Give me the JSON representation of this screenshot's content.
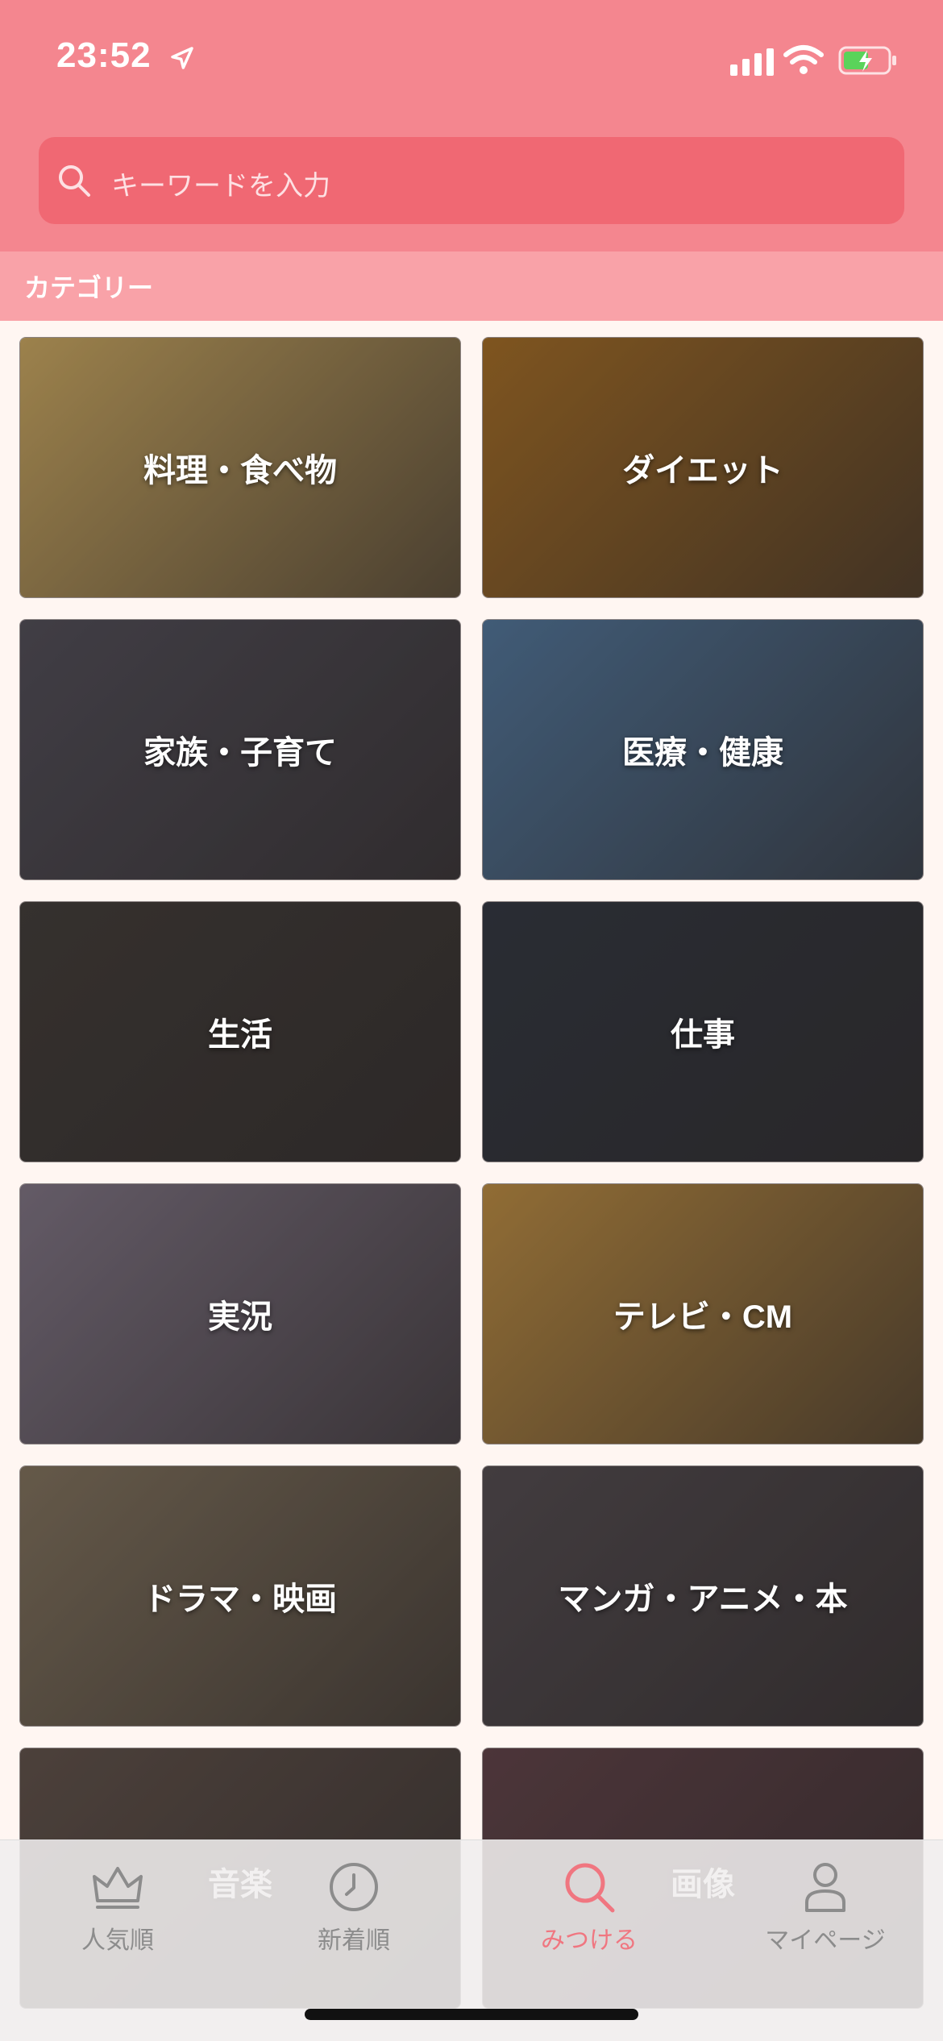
{
  "status_bar": {
    "time": "23:52"
  },
  "search": {
    "placeholder": "キーワードを入力"
  },
  "section": {
    "title": "カテゴリー"
  },
  "categories": [
    {
      "label": "料理・食べ物",
      "color": "#d9b46a"
    },
    {
      "label": "ダイエット",
      "color": "#b0762c"
    },
    {
      "label": "家族・子育て",
      "color": "#5a5660"
    },
    {
      "label": "医療・健康",
      "color": "#5a7fa5"
    },
    {
      "label": "生活",
      "color": "#4a4440"
    },
    {
      "label": "仕事",
      "color": "#3a3e48"
    },
    {
      "label": "実況",
      "color": "#8a7e8e"
    },
    {
      "label": "テレビ・CM",
      "color": "#c9974a"
    },
    {
      "label": "ドラマ・映画",
      "color": "#8c7c66"
    },
    {
      "label": "マンガ・アニメ・本",
      "color": "#5c5458"
    },
    {
      "label": "音楽",
      "color": "#6a5a52"
    },
    {
      "label": "画像",
      "color": "#6a4a50"
    }
  ],
  "tabbar": {
    "items": [
      {
        "label": "人気順",
        "icon": "crown-icon"
      },
      {
        "label": "新着順",
        "icon": "clock-icon"
      },
      {
        "label": "みつける",
        "icon": "search-icon"
      },
      {
        "label": "マイページ",
        "icon": "person-icon"
      }
    ],
    "active_color": "#f07680"
  },
  "colors": {
    "header": "#f4868f",
    "search_bg": "#f06873",
    "section_bar": "#f9a2a8"
  }
}
